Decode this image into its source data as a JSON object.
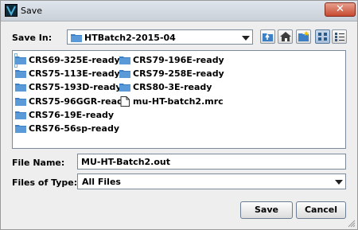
{
  "window": {
    "title": "Save",
    "close_symbol": "✕"
  },
  "save_in": {
    "label": "Save In:",
    "label_mnemonic": "I",
    "folder": "HTBatch2-2015-04",
    "icon": "folder-icon"
  },
  "toolbar": {
    "buttons": [
      {
        "name": "up-one-level-icon"
      },
      {
        "name": "home-icon"
      },
      {
        "name": "new-folder-icon"
      },
      {
        "name": "list-view-icon",
        "active": true
      },
      {
        "name": "details-view-icon"
      }
    ]
  },
  "files": [
    {
      "name": "CRS69-325E-ready",
      "type": "folder",
      "selected": true
    },
    {
      "name": "CRS75-113E-ready",
      "type": "folder"
    },
    {
      "name": "CRS75-193D-ready",
      "type": "folder"
    },
    {
      "name": "CRS75-96GGR-ready",
      "type": "folder"
    },
    {
      "name": "CRS76-19E-ready",
      "type": "folder"
    },
    {
      "name": "CRS76-56sp-ready",
      "type": "folder"
    },
    {
      "name": "CRS79-196E-ready",
      "type": "folder"
    },
    {
      "name": "CRS79-258E-ready",
      "type": "folder"
    },
    {
      "name": "CRS80-3E-ready",
      "type": "folder"
    },
    {
      "name": "mu-HT-batch2.mrc",
      "type": "file"
    }
  ],
  "file_name": {
    "label": "File Name:",
    "value": "MU-HT-Batch2.out"
  },
  "files_of_type": {
    "label": "Files of Type:",
    "value": "All Files"
  },
  "buttons": {
    "save": "Save",
    "cancel": "Cancel"
  },
  "colors": {
    "folder": "#3d7fc4",
    "titlebar": "#d3d9e0",
    "close": "#c64a30"
  }
}
